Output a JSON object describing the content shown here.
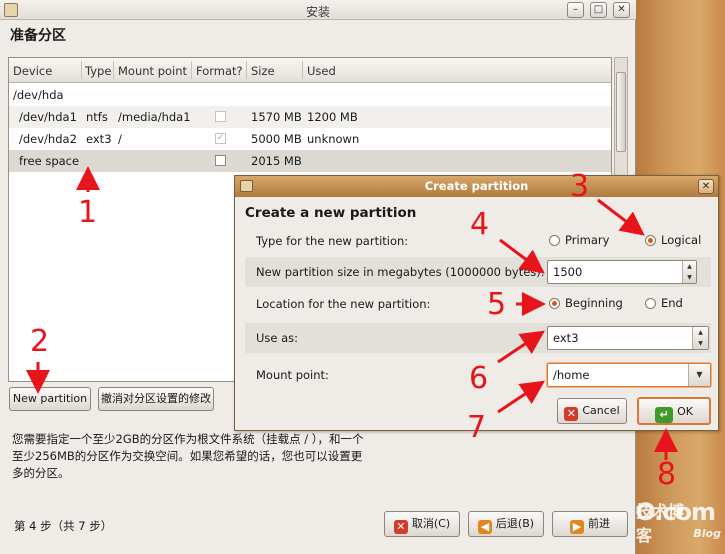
{
  "window": {
    "title": "安装",
    "heading": "准备分区"
  },
  "table": {
    "columns": [
      "Device",
      "Type",
      "Mount point",
      "Format?",
      "Size",
      "Used"
    ],
    "rows": [
      {
        "device": "/dev/hda",
        "type": "",
        "mount": "",
        "format": "",
        "size": "",
        "used": ""
      },
      {
        "device": "/dev/hda1",
        "type": "ntfs",
        "mount": "/media/hda1",
        "format": "unchecked",
        "size": "1570 MB",
        "used": "1200 MB"
      },
      {
        "device": "/dev/hda2",
        "type": "ext3",
        "mount": "/",
        "format": "checked",
        "size": "5000 MB",
        "used": "unknown"
      },
      {
        "device": "free space",
        "type": "",
        "mount": "",
        "format": "unchecked",
        "size": "2015 MB",
        "used": ""
      }
    ]
  },
  "buttons": {
    "new_partition": "New partition",
    "undo_changes": "撤消对分区设置的修改",
    "cancel": "取消(C)",
    "back": "后退(B)",
    "forward": "前进"
  },
  "info_text": "您需要指定一个至少2GB的分区作为根文件系统（挂载点 / ），和一个至少256MB的分区作为交换空间。如果您希望的话，您也可以设置更多的分区。",
  "step_text": "第 4 步（共 7 步）",
  "dialog": {
    "title": "Create partition",
    "heading": "Create a new partition",
    "type_label": "Type for the new partition:",
    "type_options": [
      "Primary",
      "Logical"
    ],
    "type_selected": "Logical",
    "size_label": "New partition size in megabytes (1000000 bytes):",
    "size_value": "1500",
    "location_label": "Location for the new partition:",
    "location_options": [
      "Beginning",
      "End"
    ],
    "location_selected": "Beginning",
    "use_as_label": "Use as:",
    "use_as_value": "ext3",
    "mount_label": "Mount point:",
    "mount_value": "/home",
    "cancel_label": "Cancel",
    "ok_label": "OK"
  },
  "annotations": [
    "1",
    "2",
    "3",
    "4",
    "5",
    "6",
    "7",
    "8"
  ],
  "watermark": {
    "site": "51CTO.com",
    "sub": "技术博客",
    "blog": "Blog"
  },
  "colors": {
    "annotation": "#e8141b",
    "dialog_title": "#b07a3c",
    "radio_dot": "#d35b1a",
    "desktop": "#cf9a5d"
  },
  "icons": [
    "close-icon",
    "minimize-icon",
    "maximize-icon",
    "cancel-x-icon",
    "ok-arrow-icon",
    "back-arrow-icon",
    "forward-arrow-icon"
  ]
}
